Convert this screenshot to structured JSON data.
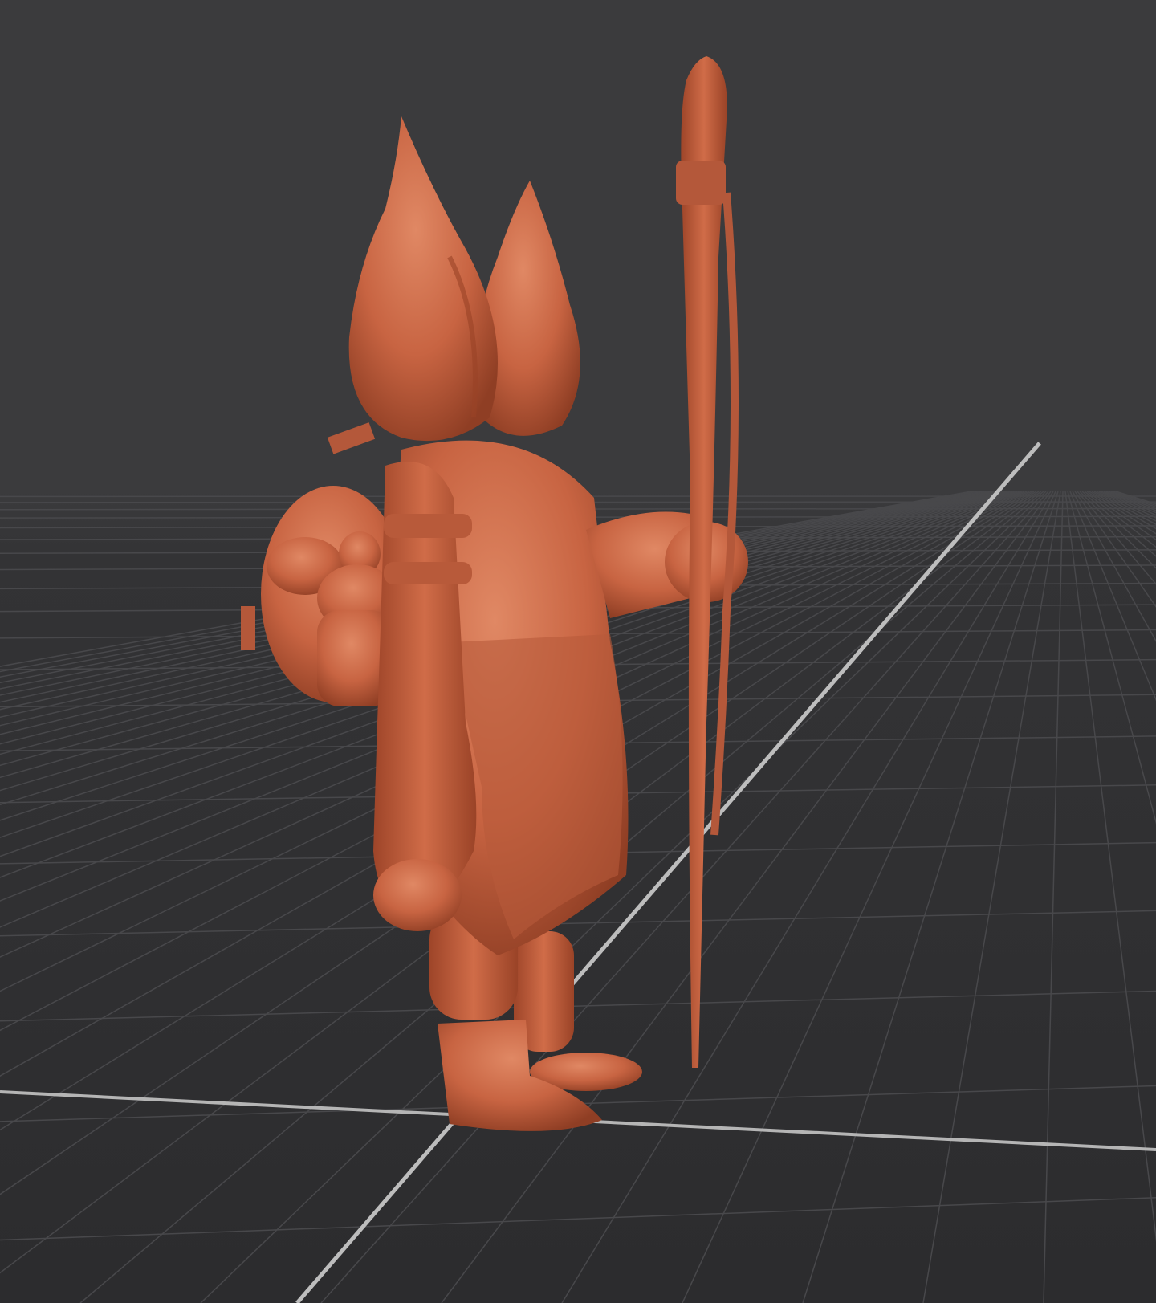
{
  "app": {
    "view": "3d-sculpt-viewport"
  },
  "scene": {
    "subject": "sculpted-character-with-staff",
    "background_color": "#3b3b3d",
    "floor_color": "#2f2f31",
    "grid_line_color": "#4a4a4d",
    "axis_line_color": "#b9b9b9",
    "clay_color": "#c86442",
    "clay_shadow_color": "#8f3e24",
    "clay_highlight_color": "#e08864",
    "icons": [
      "clay-model",
      "wooden-staff",
      "backpack",
      "floor-grid"
    ]
  }
}
